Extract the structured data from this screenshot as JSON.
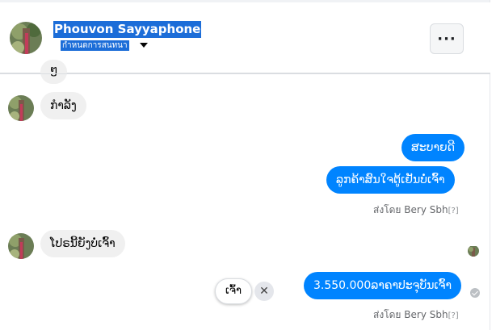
{
  "header": {
    "name": "Phouvon Sayyaphone",
    "status": "กำหนดการสนทนา",
    "more_label": "···"
  },
  "messages": [
    {
      "dir": "in",
      "text": "ໆ"
    },
    {
      "dir": "in",
      "text": "ກໍາລັງ"
    },
    {
      "dir": "out",
      "text": "ສະບາຍດີ"
    },
    {
      "dir": "out",
      "text": "ລູກຄ້າສົນໃຈຕູ້ເຢັນບໍ່ເຈົ້າ"
    },
    {
      "dir": "in",
      "text": "ໂປຣນີ້ຍັງບໍ່ເຈົ້າ"
    },
    {
      "dir": "out",
      "text": "3.550.000ລາຄາປະຈຸບັນເຈົ້າ"
    }
  ],
  "sent_by": {
    "first": "ส่งโดย Bery Sbh",
    "second": "ส่งโดย Bery Sbh",
    "help_mark": "[?]"
  },
  "quick_reply": {
    "label": "ເຈົ້າ",
    "close": "✕"
  },
  "colors": {
    "outgoing": "#0084ff",
    "incoming": "#f0f0f0",
    "highlight": "#1c6dd8"
  },
  "icons": {
    "more": "more-icon",
    "caret": "caret-down-icon",
    "close": "close-icon",
    "seen": "seen-avatar-icon",
    "delivered": "check-circle-icon"
  }
}
